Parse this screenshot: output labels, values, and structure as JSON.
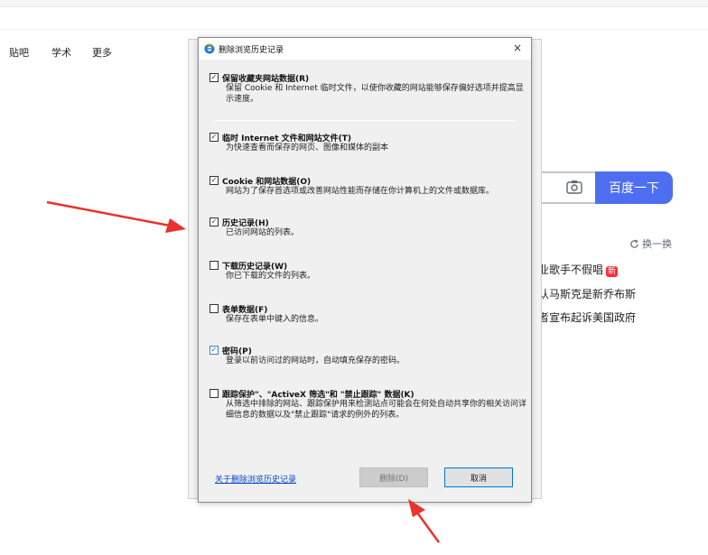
{
  "browser": {
    "nav_items": [
      "贴吧",
      "学术",
      "更多"
    ],
    "search_button": "百度一下",
    "refresh_label": "换一换",
    "hot_items": [
      {
        "text": "业歌手不假唱",
        "badge": "新"
      },
      {
        "text": "认马斯克是新乔布斯",
        "badge": ""
      },
      {
        "text": "者宣布起诉美国政府",
        "badge": ""
      }
    ],
    "accent_color": "#4e6ef2"
  },
  "dialog": {
    "title": "删除浏览历史记录",
    "close_label": "×",
    "options": [
      {
        "checked": true,
        "title": "保留收藏夹网站数据(R)",
        "desc": "保留 Cookie 和 Internet 临时文件，以使你收藏的网站能够保存偏好选项并提高显示速度。"
      },
      {
        "checked": true,
        "title": "临时 Internet 文件和网站文件(T)",
        "desc": "为快速查看而保存的网页、图像和媒体的副本"
      },
      {
        "checked": true,
        "title": "Cookie 和网站数据(O)",
        "desc": "网站为了保存首选项或改善网站性能而存储在你计算机上的文件或数据库。"
      },
      {
        "checked": true,
        "title": "历史记录(H)",
        "desc": "已访问网站的列表。"
      },
      {
        "checked": false,
        "title": "下载历史记录(W)",
        "desc": "你已下载的文件的列表。"
      },
      {
        "checked": false,
        "title": "表单数据(F)",
        "desc": "保存在表单中键入的信息。"
      },
      {
        "checked": true,
        "title": "密码(P)",
        "desc": "登录以前访问过的网站时，自动填充保存的密码。"
      },
      {
        "checked": false,
        "title": "跟踪保护\"、\"ActiveX 筛选\"和 \"禁止跟踪\" 数据(K)",
        "desc": "从筛选中排除的网站、跟踪保护用来检测站点可能会在何处自动共享你的相关访问详细信息的数据以及\"禁止跟踪\"请求的例外的列表。"
      }
    ],
    "about_link": "关于删除浏览历史记录",
    "delete_button": "删除(D)",
    "cancel_button": "取消",
    "checkmark": "✓"
  },
  "annotation_color": "#e8332e"
}
